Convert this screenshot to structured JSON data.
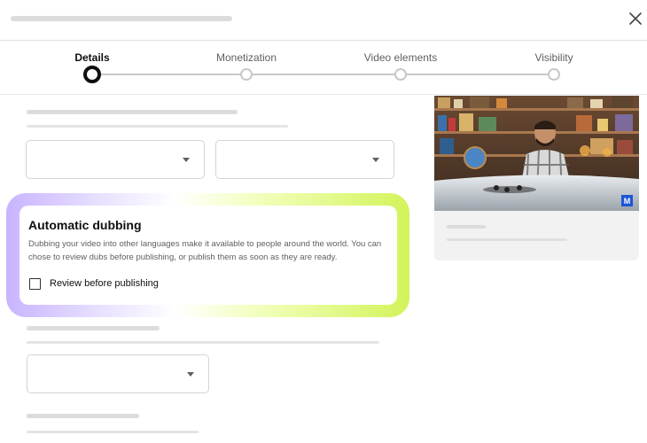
{
  "stepper": {
    "steps": [
      {
        "label": "Details"
      },
      {
        "label": "Monetization"
      },
      {
        "label": "Video elements"
      },
      {
        "label": "Visibility"
      }
    ],
    "active_index": 0
  },
  "dubbing": {
    "title": "Automatic dubbing",
    "description": "Dubbing your video into other languages make it available to people around the world. You can chose to review dubs before publishing, or publish them as soon as they are ready.",
    "checkbox_label": "Review before publishing",
    "checkbox_checked": false
  },
  "preview": {
    "badge": "M"
  },
  "icons": {
    "close": "close-icon",
    "dropdown": "chevron-down-icon"
  },
  "colors": {
    "active_step": "#0f0f0f",
    "inactive_step": "#c8c8c8",
    "glow_start": "#c8b4ff",
    "glow_end": "#d3f35a",
    "badge": "#1a56d6"
  }
}
